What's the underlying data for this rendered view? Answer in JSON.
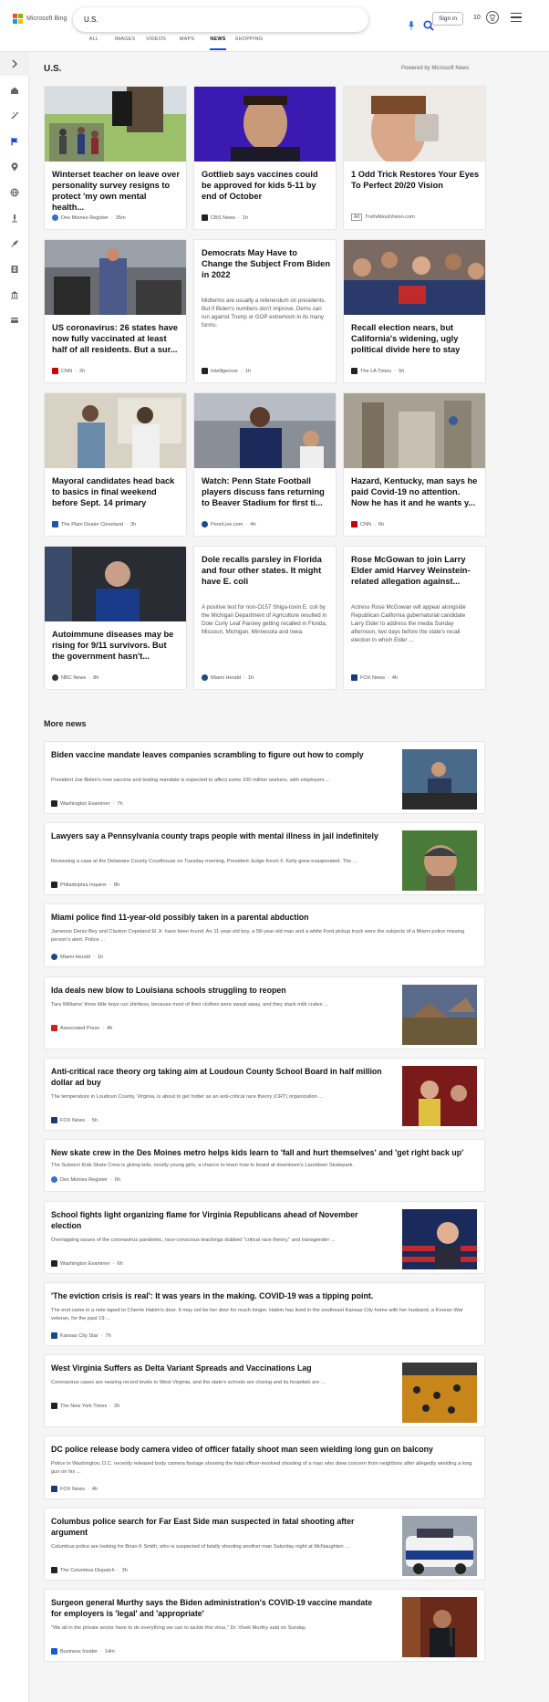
{
  "header": {
    "logo_text": "Microsoft Bing",
    "search_value": "U.S.",
    "signin_label": "Sign in",
    "reward_points": "10"
  },
  "nav_tabs": [
    {
      "label": "ALL"
    },
    {
      "label": "IMAGES"
    },
    {
      "label": "VIDEOS"
    },
    {
      "label": "MAPS"
    },
    {
      "label": "NEWS",
      "active": true
    },
    {
      "label": "SHOPPING"
    }
  ],
  "sidebar_icons": [
    "chevron-right-icon",
    "home-icon",
    "magic-icon",
    "flag-icon",
    "location-icon",
    "globe-icon",
    "microscope-icon",
    "rocket-icon",
    "film-icon",
    "bank-icon",
    "card-icon"
  ],
  "section": {
    "title": "U.S.",
    "powered_by": "Powered by Microsoft News"
  },
  "cards": [
    {
      "title": "Winterset teacher on leave over personality survey resigns to protect 'my own mental health...",
      "desc": "",
      "source": "Des Moines Register",
      "time": "35m",
      "ad": ""
    },
    {
      "title": "Gottlieb says vaccines could be approved for kids 5-11 by end of October",
      "desc": "",
      "source": "CBS News",
      "time": "1h",
      "ad": ""
    },
    {
      "title": "1 Odd Trick Restores Your Eyes To Perfect 20/20 Vision",
      "desc": "",
      "source": "TruthAboutVision.com",
      "time": "",
      "ad": "Ad"
    },
    {
      "title": "US coronavirus: 26 states have now fully vaccinated at least half of all residents. But a sur...",
      "desc": "",
      "source": "CNN",
      "time": "2h",
      "ad": ""
    },
    {
      "title": "Democrats May Have to Change the Subject From Biden in 2022",
      "desc": "Midterms are usually a referendum on presidents. But if Biden's numbers don't improve, Dems can run against Trump or GOP extremism in its many forms.",
      "source": "Intelligencer",
      "time": "1h",
      "ad": ""
    },
    {
      "title": "Recall election nears, but California's widening, ugly political divide here to stay",
      "desc": "",
      "source": "The LA Times",
      "time": "5h",
      "ad": ""
    },
    {
      "title": "Mayoral candidates head back to basics in final weekend before Sept. 14 primary",
      "desc": "",
      "source": "The Plain Dealer Cleveland",
      "time": "3h",
      "ad": ""
    },
    {
      "title": "Watch: Penn State Football players discuss fans returning to Beaver Stadium for first ti...",
      "desc": "",
      "source": "PennLive.com",
      "time": "4h",
      "ad": ""
    },
    {
      "title": "Hazard, Kentucky, man says he paid Covid-19 no attention. Now he has it and he wants y...",
      "desc": "",
      "source": "CNN",
      "time": "6h",
      "ad": ""
    },
    {
      "title": "Autoimmune diseases may be rising for 9/11 survivors. But the government hasn't...",
      "desc": "",
      "source": "NBC News",
      "time": "8h",
      "ad": ""
    },
    {
      "title": "Dole recalls parsley in Florida and four other states. It might have E. coli",
      "desc": "A positive test for non-O157 Shiga-toxin E. coli by the Michigan Department of Agriculture resulted in Dole Curly Leaf Parsley getting recalled in Florida, Missouri, Michigan, Minnesota and Iowa.",
      "source": "Miami Herald",
      "time": "1h",
      "ad": ""
    },
    {
      "title": "Rose McGowan to join Larry Elder amid Harvey Weinstein-related allegation against...",
      "desc": "Actress Rose McGowan will appear alongside Republican California gubernatorial candidate Larry Elder to address the media Sunday afternoon, two days before the state's recall election in which Elder ...",
      "source": "FOX News",
      "time": "4h",
      "ad": ""
    }
  ],
  "more_news": {
    "title": "More news",
    "items": [
      {
        "title": "Biden vaccine mandate leaves companies scrambling to figure out how to comply",
        "snippet": "President Joe Biden's new vaccine and testing mandate is expected to affect some 100 million workers, with employers ...",
        "source": "Washington Examiner",
        "time": "7h"
      },
      {
        "title": "Lawyers say a Pennsylvania county traps people with mental illness in jail indefinitely",
        "snippet": "Reviewing a case at the Delaware County Courthouse on Tuesday morning, President Judge Kevin F. Kelly grew exasperated. The ...",
        "source": "Philadelphia Inquirer",
        "time": "8h"
      },
      {
        "title": "Miami police find 11-year-old possibly taken in a parental abduction",
        "snippet": "Jameson Deniz-Bey and Claxton Copeland El Jr. have been found. An 11-year-old boy, a 58-year-old man and a white Ford pickup truck were the subjects of a Miami police missing person's alert. Police ...",
        "source": "Miami Herald",
        "time": "1h"
      },
      {
        "title": "Ida deals new blow to Louisiana schools struggling to reopen",
        "snippet": "Tara Williams' three little boys run shirtless, because most of their clothes were swept away, and they stack milk crates ...",
        "source": "Associated Press",
        "time": "4h"
      },
      {
        "title": "Anti-critical race theory org taking aim at Loudoun County School Board in half million dollar ad buy",
        "snippet": "The temperature in Loudoun County, Virginia, is about to get hotter as an anti-critical race theory (CRT) organization ...",
        "source": "FOX News",
        "time": "5h"
      },
      {
        "title": "New skate crew in the Des Moines metro helps kids learn to 'fall and hurt themselves' and 'get right back up'",
        "snippet": "The Subsect Kids Skate Crew is giving kids, mostly young girls, a chance to learn how to board at downtown's Lauridsen Skatepark.",
        "source": "Des Moines Register",
        "time": "6h"
      },
      {
        "title": "School fights light organizing flame for Virginia Republicans ahead of November election",
        "snippet": "Overlapping issues of the coronavirus pandemic, race-conscious teachings dubbed \"critical race theory,\" and transgender ...",
        "source": "Washington Examiner",
        "time": "6h"
      },
      {
        "title": "'The eviction crisis is real': It was years in the making. COVID-19 was a tipping point.",
        "snippet": "The end came in a note taped to Cherrie Hakim's door. It may not be her door for much longer. Hakim has lived in the southeast Kansas City home with her husband, a Korean War veteran, for the past 19 ...",
        "source": "Kansas City Star",
        "time": "7h"
      },
      {
        "title": "West Virginia Suffers as Delta Variant Spreads and Vaccinations Lag",
        "snippet": "Coronavirus cases are nearing record levels in West Virginia, and the state's schools are closing and its hospitals are ...",
        "source": "The New York Times",
        "time": "2h"
      },
      {
        "title": "DC police release body camera video of officer fatally shoot man seen wielding long gun on balcony",
        "snippet": "Police in Washington, D.C. recently released body camera footage showing the fatal officer-involved shooting of a man who drew concern from neighbors after allegedly wielding a long gun on his ...",
        "source": "FOX News",
        "time": "4h"
      },
      {
        "title": "Columbus police search for Far East Side man suspected in fatal shooting after argument",
        "snippet": "Columbus police are looking for Brian K Smith, who is suspected of fatally shooting another man Saturday night at McNaughten ...",
        "source": "The Columbus Dispatch",
        "time": "3h"
      },
      {
        "title": "Surgeon general Murthy says the Biden administration's COVID-19 vaccine mandate for employers is 'legal' and 'appropriate'",
        "snippet": "\"We all in the private sector have to do everything we can to tackle this virus,\" Dr. Vivek Murthy said on Sunday.",
        "source": "Business Insider",
        "time": "14m"
      }
    ]
  },
  "colors": {
    "accent": "#174ae4",
    "background": "#f5f5f5",
    "card": "#ffffff"
  }
}
